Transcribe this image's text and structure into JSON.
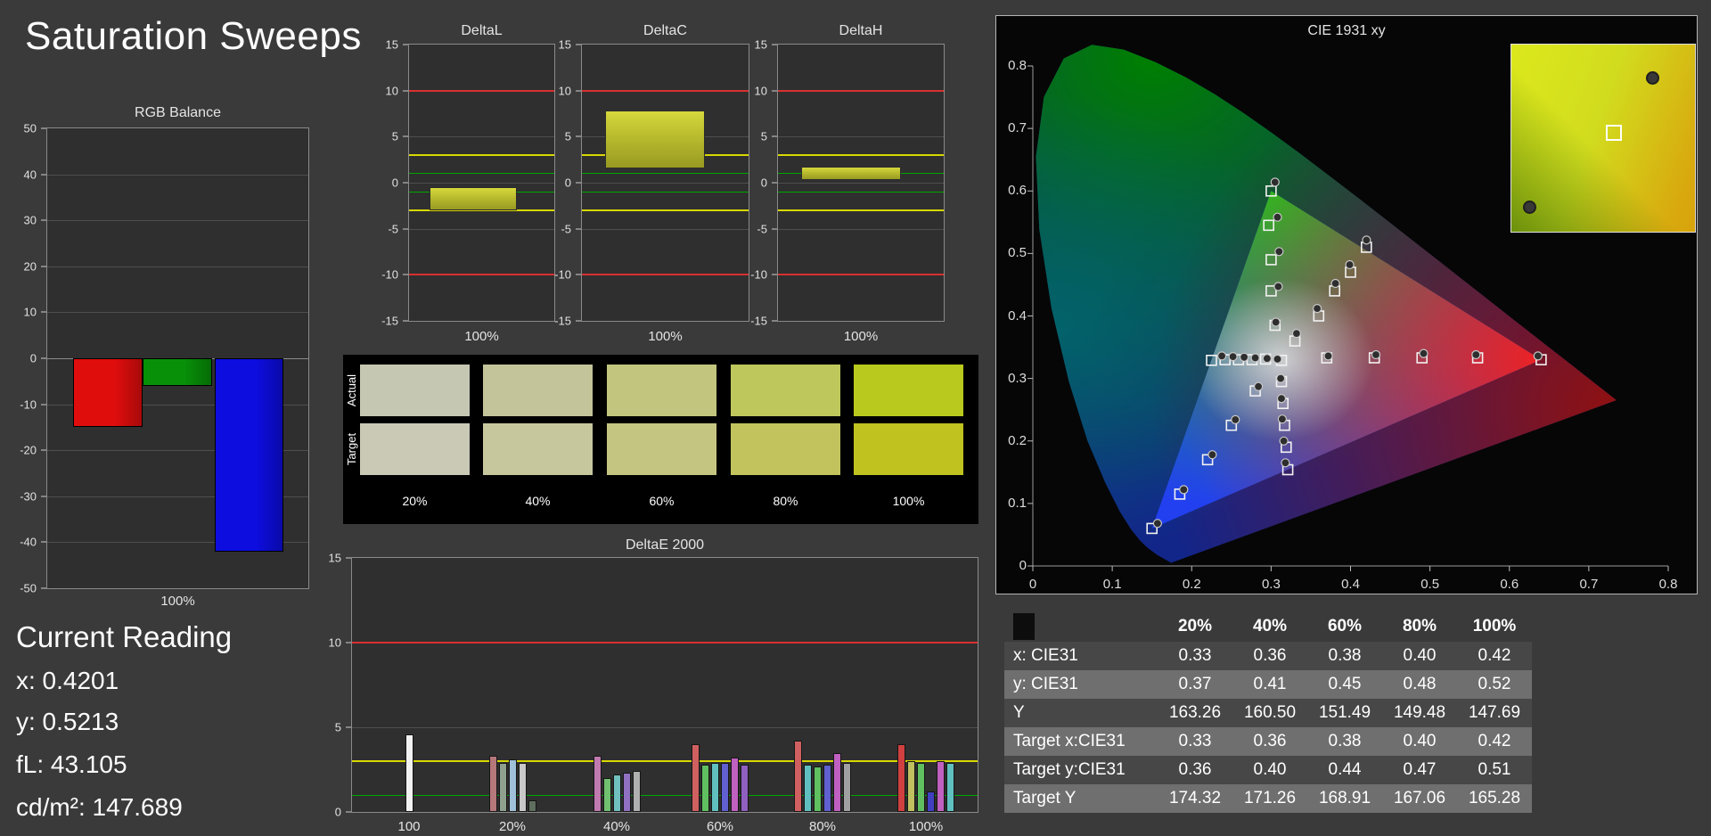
{
  "header": {
    "title": "Saturation Sweeps"
  },
  "current_reading": {
    "title": "Current Reading",
    "lines": [
      "x: 0.4201",
      "y: 0.5213",
      "fL: 43.105",
      "cd/m²: 147.689"
    ]
  },
  "swatch_panel": {
    "row_labels": [
      "Actual",
      "Target"
    ],
    "col_labels": [
      "20%",
      "40%",
      "60%",
      "80%",
      "100%"
    ],
    "actual_colors": [
      "#c6c7b3",
      "#c3c499",
      "#c1c57d",
      "#bec75c",
      "#bac91d"
    ],
    "target_colors": [
      "#c9c9b6",
      "#c7c79e",
      "#c5c582",
      "#c2c35d",
      "#bfc21f"
    ]
  },
  "table": {
    "col_headers": [
      "20%",
      "40%",
      "60%",
      "80%",
      "100%"
    ],
    "rows": [
      {
        "label": "x: CIE31",
        "values": [
          "0.33",
          "0.36",
          "0.38",
          "0.40",
          "0.42"
        ]
      },
      {
        "label": "y: CIE31",
        "values": [
          "0.37",
          "0.41",
          "0.45",
          "0.48",
          "0.52"
        ]
      },
      {
        "label": "Y",
        "values": [
          "163.26",
          "160.50",
          "151.49",
          "149.48",
          "147.69"
        ]
      },
      {
        "label": "Target x:CIE31",
        "values": [
          "0.33",
          "0.36",
          "0.38",
          "0.40",
          "0.42"
        ]
      },
      {
        "label": "Target y:CIE31",
        "values": [
          "0.36",
          "0.40",
          "0.44",
          "0.47",
          "0.51"
        ]
      },
      {
        "label": "Target Y",
        "values": [
          "174.32",
          "171.26",
          "168.91",
          "167.06",
          "165.28"
        ]
      }
    ],
    "row_colors": [
      "#474747",
      "#6f6f6f",
      "#474747",
      "#6f6f6f",
      "#474747",
      "#6f6f6f"
    ]
  },
  "chart_data": [
    {
      "id": "rgb_balance",
      "type": "bar",
      "title": "RGB Balance",
      "xlabel": "100%",
      "ylim": [
        -50,
        50
      ],
      "yticks": [
        50,
        40,
        30,
        20,
        10,
        0,
        -10,
        -20,
        -30,
        -40,
        -50
      ],
      "categories": [
        "Red",
        "Green",
        "Blue"
      ],
      "values": [
        -15,
        -6,
        -42
      ],
      "colors": [
        "#e00d0d",
        "#089008",
        "#0d0de0"
      ]
    },
    {
      "id": "deltaL",
      "type": "range_bar",
      "title": "DeltaL",
      "xlabel": "100%",
      "ylim": [
        -15,
        15
      ],
      "yticks": [
        15,
        10,
        5,
        0,
        -5,
        -10,
        -15
      ],
      "ref_lines": [
        {
          "value": 10,
          "color": "#d83030",
          "h": 2
        },
        {
          "value": -10,
          "color": "#d83030",
          "h": 2
        },
        {
          "value": 3,
          "color": "#d8d800",
          "h": 2
        },
        {
          "value": -3,
          "color": "#d8d800",
          "h": 2
        },
        {
          "value": 1,
          "color": "#00a800",
          "h": 1
        },
        {
          "value": -1,
          "color": "#00a800",
          "h": 1
        }
      ],
      "range": [
        -3.0,
        -0.5
      ]
    },
    {
      "id": "deltaC",
      "type": "range_bar",
      "title": "DeltaC",
      "xlabel": "100%",
      "ylim": [
        -15,
        15
      ],
      "yticks": [
        15,
        10,
        5,
        0,
        -5,
        -10,
        -15
      ],
      "ref_lines": [
        {
          "value": 10,
          "color": "#d83030",
          "h": 2
        },
        {
          "value": -10,
          "color": "#d83030",
          "h": 2
        },
        {
          "value": 3,
          "color": "#d8d800",
          "h": 2
        },
        {
          "value": -3,
          "color": "#d8d800",
          "h": 2
        },
        {
          "value": 1,
          "color": "#00a800",
          "h": 1
        },
        {
          "value": -1,
          "color": "#00a800",
          "h": 1
        }
      ],
      "range": [
        1.5,
        7.8
      ]
    },
    {
      "id": "deltaH",
      "type": "range_bar",
      "title": "DeltaH",
      "xlabel": "100%",
      "ylim": [
        -15,
        15
      ],
      "yticks": [
        15,
        10,
        5,
        0,
        -5,
        -10,
        -15
      ],
      "ref_lines": [
        {
          "value": 10,
          "color": "#d83030",
          "h": 2
        },
        {
          "value": -10,
          "color": "#d83030",
          "h": 2
        },
        {
          "value": 3,
          "color": "#d8d800",
          "h": 2
        },
        {
          "value": -3,
          "color": "#d8d800",
          "h": 2
        },
        {
          "value": 1,
          "color": "#00a800",
          "h": 1
        },
        {
          "value": -1,
          "color": "#00a800",
          "h": 1
        }
      ],
      "range": [
        0.3,
        1.7
      ]
    },
    {
      "id": "deltaE",
      "type": "grouped_bar",
      "title": "DeltaE 2000",
      "ylim": [
        0,
        15
      ],
      "yticks": [
        15,
        10,
        5,
        0
      ],
      "ref_lines": [
        {
          "value": 10,
          "color": "#d83030",
          "h": 2
        },
        {
          "value": 3,
          "color": "#d8d800",
          "h": 2
        },
        {
          "value": 1,
          "color": "#00a800",
          "h": 1
        }
      ],
      "groups": [
        {
          "label": "100",
          "bars": [
            {
              "color": "#f2f2f2",
              "value": 4.6
            }
          ]
        },
        {
          "label": "20%",
          "bars": [
            {
              "color": "#b5787b",
              "value": 3.3
            },
            {
              "color": "#8fa08f",
              "value": 2.9
            },
            {
              "color": "#9fc0d8",
              "value": 3.1
            },
            {
              "color": "#c8c8c8",
              "value": 2.9
            },
            {
              "color": "#5f6f5f",
              "value": 0.7
            }
          ]
        },
        {
          "label": "40%",
          "bars": [
            {
              "color": "#c07ab0",
              "value": 3.3
            },
            {
              "color": "#70c070",
              "value": 2.0
            },
            {
              "color": "#70c0c0",
              "value": 2.2
            },
            {
              "color": "#9070c0",
              "value": 2.3
            },
            {
              "color": "#b0b0b0",
              "value": 2.4
            }
          ]
        },
        {
          "label": "60%",
          "bars": [
            {
              "color": "#d06060",
              "value": 4.0
            },
            {
              "color": "#60c060",
              "value": 2.8
            },
            {
              "color": "#60c0c0",
              "value": 2.9
            },
            {
              "color": "#6060d0",
              "value": 2.9
            },
            {
              "color": "#c060c0",
              "value": 3.2
            },
            {
              "color": "#9060c0",
              "value": 2.8
            }
          ]
        },
        {
          "label": "80%",
          "bars": [
            {
              "color": "#d06060",
              "value": 4.2
            },
            {
              "color": "#60c0c0",
              "value": 2.8
            },
            {
              "color": "#60c060",
              "value": 2.7
            },
            {
              "color": "#6060d0",
              "value": 2.8
            },
            {
              "color": "#c060c0",
              "value": 3.5
            },
            {
              "color": "#a0a0a0",
              "value": 2.9
            }
          ]
        },
        {
          "label": "100%",
          "bars": [
            {
              "color": "#d04040",
              "value": 4.0
            },
            {
              "color": "#c0c060",
              "value": 3.0
            },
            {
              "color": "#60c060",
              "value": 2.9
            },
            {
              "color": "#4040c0",
              "value": 1.2
            },
            {
              "color": "#c060c0",
              "value": 3.0
            },
            {
              "color": "#60c0c0",
              "value": 2.9
            }
          ]
        }
      ]
    },
    {
      "id": "cie",
      "type": "scatter",
      "title": "CIE 1931 xy",
      "xlim": [
        0,
        0.8
      ],
      "ylim": [
        0,
        0.8
      ],
      "xticks": [
        0,
        0.1,
        0.2,
        0.3,
        0.4,
        0.5,
        0.6,
        0.7,
        0.8
      ],
      "yticks": [
        0,
        0.1,
        0.2,
        0.3,
        0.4,
        0.5,
        0.6,
        0.7,
        0.8
      ],
      "gamut_triangle": [
        [
          0.64,
          0.33
        ],
        [
          0.3,
          0.6
        ],
        [
          0.15,
          0.06
        ]
      ],
      "targets": [
        [
          0.33,
          0.36
        ],
        [
          0.36,
          0.4
        ],
        [
          0.38,
          0.44
        ],
        [
          0.4,
          0.47
        ],
        [
          0.42,
          0.51
        ],
        [
          0.37,
          0.333
        ],
        [
          0.43,
          0.333
        ],
        [
          0.49,
          0.333
        ],
        [
          0.56,
          0.333
        ],
        [
          0.64,
          0.33
        ],
        [
          0.305,
          0.385
        ],
        [
          0.3,
          0.44
        ],
        [
          0.3,
          0.49
        ],
        [
          0.297,
          0.545
        ],
        [
          0.3,
          0.6
        ],
        [
          0.28,
          0.28
        ],
        [
          0.25,
          0.225
        ],
        [
          0.22,
          0.17
        ],
        [
          0.185,
          0.115
        ],
        [
          0.15,
          0.06
        ],
        [
          0.313,
          0.295
        ],
        [
          0.315,
          0.26
        ],
        [
          0.317,
          0.225
        ],
        [
          0.319,
          0.19
        ],
        [
          0.321,
          0.154
        ],
        [
          0.293,
          0.331
        ],
        [
          0.276,
          0.33
        ],
        [
          0.259,
          0.33
        ],
        [
          0.242,
          0.33
        ],
        [
          0.225,
          0.329
        ],
        [
          0.313,
          0.329
        ]
      ],
      "measured": [
        [
          0.332,
          0.372
        ],
        [
          0.358,
          0.412
        ],
        [
          0.381,
          0.452
        ],
        [
          0.399,
          0.482
        ],
        [
          0.4201,
          0.5213
        ],
        [
          0.372,
          0.336
        ],
        [
          0.432,
          0.338
        ],
        [
          0.492,
          0.34
        ],
        [
          0.558,
          0.338
        ],
        [
          0.636,
          0.336
        ],
        [
          0.306,
          0.39
        ],
        [
          0.309,
          0.447
        ],
        [
          0.31,
          0.503
        ],
        [
          0.308,
          0.558
        ],
        [
          0.305,
          0.614
        ],
        [
          0.284,
          0.287
        ],
        [
          0.255,
          0.234
        ],
        [
          0.226,
          0.178
        ],
        [
          0.19,
          0.122
        ],
        [
          0.157,
          0.068
        ],
        [
          0.312,
          0.3
        ],
        [
          0.313,
          0.268
        ],
        [
          0.314,
          0.235
        ],
        [
          0.316,
          0.2
        ],
        [
          0.318,
          0.165
        ],
        [
          0.295,
          0.332
        ],
        [
          0.28,
          0.333
        ],
        [
          0.266,
          0.334
        ],
        [
          0.252,
          0.335
        ],
        [
          0.238,
          0.336
        ],
        [
          0.308,
          0.331
        ]
      ],
      "inset_points": [
        {
          "kind": "measured",
          "x": 0.76,
          "y": 0.17
        },
        {
          "kind": "target",
          "x": 0.55,
          "y": 0.46
        },
        {
          "kind": "measured",
          "x": 0.09,
          "y": 0.86
        }
      ]
    }
  ]
}
